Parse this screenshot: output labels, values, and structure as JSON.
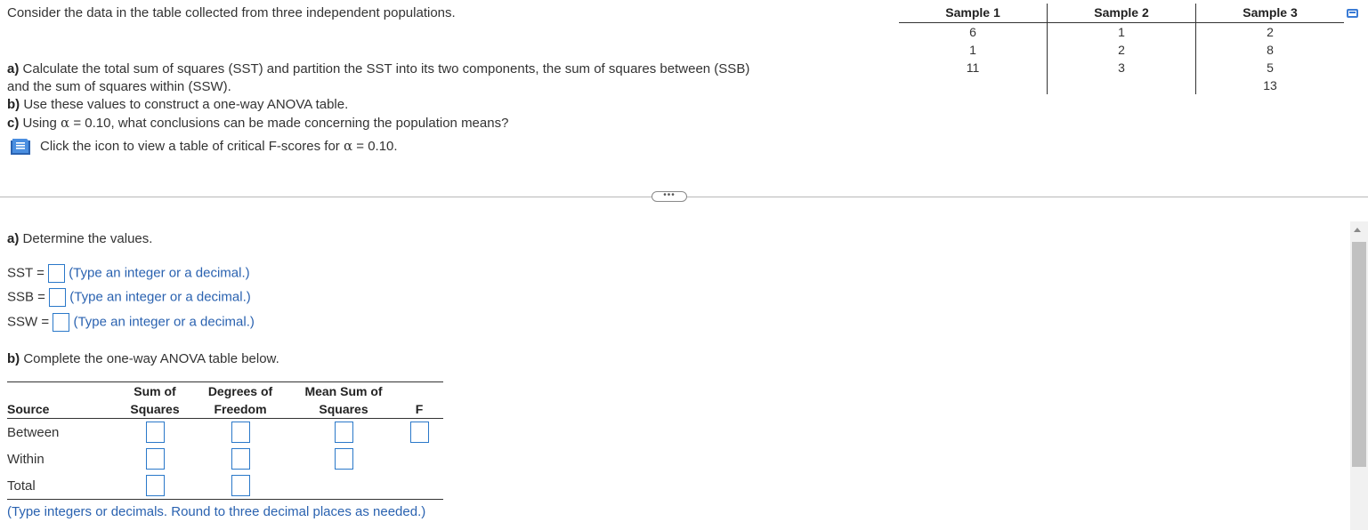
{
  "question": {
    "intro": "Consider the data in the table collected from three independent populations.",
    "part_a_label": "a)",
    "part_a_line1": "Calculate the total sum of squares (SST) and  partition the SST into its two components, the sum of squares between (SSB)",
    "part_a_line2": "and the sum of squares within (SSW).",
    "part_b_label": "b)",
    "part_b_text": "Use these values to construct a one-way ANOVA table.",
    "part_c_label": "c)",
    "part_c_pre": "Using ",
    "part_c_alpha": "α",
    "part_c_post": " = 0.10, what conclusions can be made concerning the population means?",
    "icon_text_pre": "Click the icon to view a table of critical F-scores for ",
    "icon_alpha": "α",
    "icon_text_post": " = 0.10."
  },
  "samples": {
    "headers": [
      "Sample 1",
      "Sample 2",
      "Sample 3"
    ],
    "columns": [
      [
        "6",
        "1",
        "11"
      ],
      [
        "1",
        "2",
        "3"
      ],
      [
        "2",
        "8",
        "5",
        "13"
      ]
    ]
  },
  "more_button": "•••",
  "answer": {
    "a_label": "a)",
    "a_text": "Determine the values.",
    "sst_label": "SST =",
    "ssb_label": "SSB =",
    "ssw_label": "SSW =",
    "hint": "(Type an integer or a decimal.)",
    "b_label": "b)",
    "b_text": "Complete the one-way ANOVA table below.",
    "anova": {
      "col_source": "Source",
      "col_ss_1": "Sum of",
      "col_ss_2": "Squares",
      "col_df_1": "Degrees of",
      "col_df_2": "Freedom",
      "col_ms_1": "Mean Sum of",
      "col_ms_2": "Squares",
      "col_f": "F",
      "rows": [
        "Between",
        "Within",
        "Total"
      ]
    },
    "round_hint": "(Type integers or decimals. Round to three decimal places as needed.)"
  }
}
